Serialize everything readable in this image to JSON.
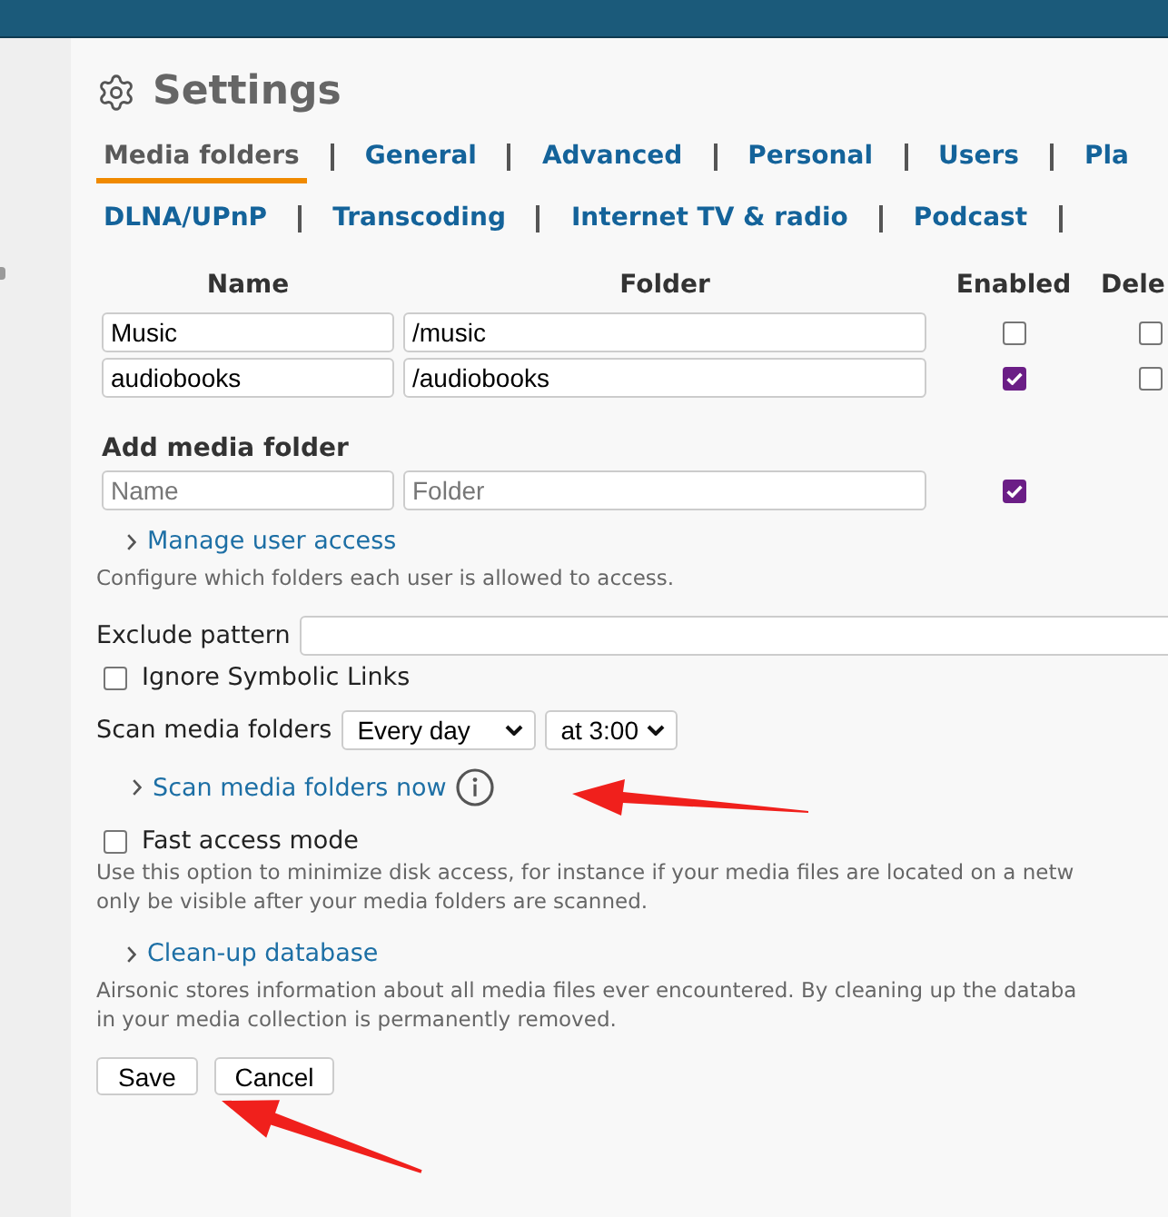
{
  "header": {
    "title": "Settings"
  },
  "tab_rows": [
    [
      {
        "label": "Media folders",
        "selected": true
      },
      {
        "label": "General",
        "selected": false
      },
      {
        "label": "Advanced",
        "selected": false
      },
      {
        "label": "Personal",
        "selected": false
      },
      {
        "label": "Users",
        "selected": false
      },
      {
        "label": "Pla",
        "selected": false
      }
    ],
    [
      {
        "label": "DLNA/UPnP",
        "selected": false
      },
      {
        "label": "Transcoding",
        "selected": false
      },
      {
        "label": "Internet TV & radio",
        "selected": false
      },
      {
        "label": "Podcast",
        "selected": false
      }
    ]
  ],
  "folders": {
    "columns": [
      "Name",
      "Folder",
      "Enabled",
      "Dele"
    ],
    "rows": [
      {
        "name": "Music",
        "folder": "/music",
        "enabled": false,
        "column_4": false
      },
      {
        "name": "audiobooks",
        "folder": "/audiobooks",
        "enabled": true,
        "column_4": false
      }
    ]
  },
  "add_folder": {
    "heading": "Add media folder",
    "name_field": {
      "placeholder": "Name"
    },
    "folder_field": {
      "placeholder": "Folder"
    },
    "enabled": true
  },
  "user_access": {
    "link": "Manage user access",
    "description": "Configure which folders each user is allowed to access."
  },
  "exclude_pattern": {
    "label": "Exclude pattern"
  },
  "ignore_symlinks": {
    "label": "Ignore Symbolic Links",
    "checked": false
  },
  "scan": {
    "label": "Scan media folders",
    "interval": "Every day",
    "time": "at 3:00",
    "link": "Scan media folders now"
  },
  "fast_access": {
    "label": "Fast access mode",
    "checked": false,
    "description_lines": [
      "Use this option to minimize disk access, for instance if your media files are located on a netw",
      "only be visible after your media folders are scanned."
    ]
  },
  "cleanup": {
    "link": "Clean-up database",
    "description_lines": [
      "Airsonic stores information about all media files ever encountered. By cleaning up the databa",
      "in your media collection is permanently removed."
    ]
  },
  "buttons": [
    "Save",
    "Cancel"
  ]
}
